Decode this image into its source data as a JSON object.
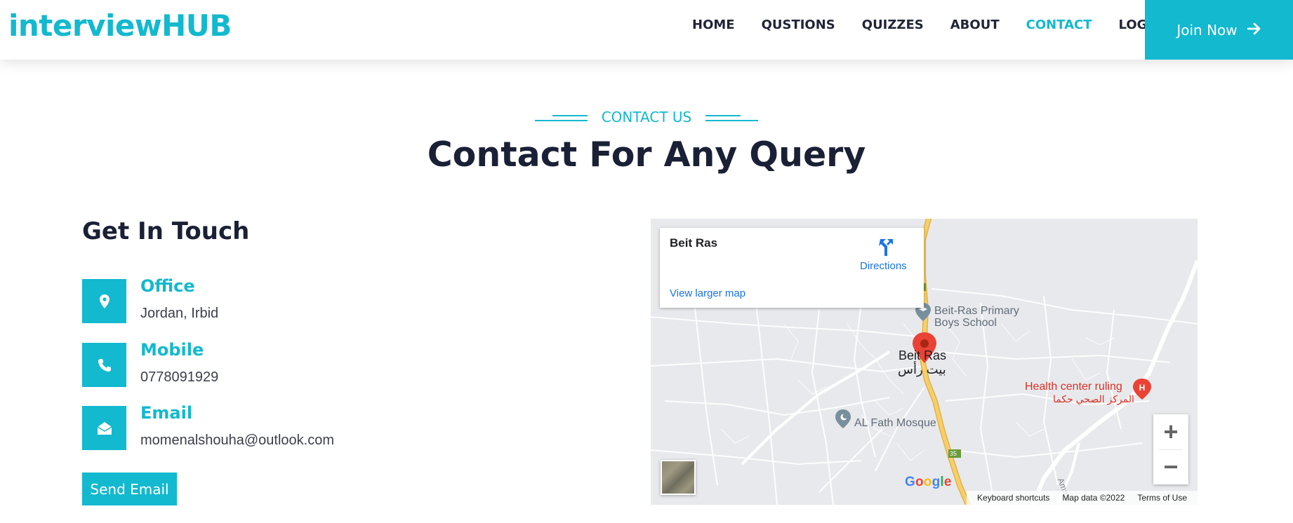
{
  "header": {
    "logo": "interviewHUB",
    "nav": [
      {
        "label": "HOME",
        "active": false
      },
      {
        "label": "QUSTIONS",
        "active": false
      },
      {
        "label": "QUIZZES",
        "active": false
      },
      {
        "label": "ABOUT",
        "active": false
      },
      {
        "label": "CONTACT",
        "active": true
      },
      {
        "label": "LOGIN",
        "active": false
      }
    ],
    "join_label": "Join Now",
    "join_icon": "arrow-right-icon"
  },
  "section": {
    "subtitle": "CONTACT US",
    "title": "Contact For Any Query"
  },
  "contact": {
    "heading": "Get In Touch",
    "items": [
      {
        "label": "Office",
        "value": "Jordan, Irbid",
        "icon": "map-pin-icon"
      },
      {
        "label": "Mobile",
        "value": "0778091929",
        "icon": "phone-icon"
      },
      {
        "label": "Email",
        "value": "momenalshouha@outlook.com",
        "icon": "envelope-open-icon"
      }
    ],
    "send_label": "Send Email"
  },
  "map": {
    "place_name": "Beit Ras",
    "directions_label": "Directions",
    "larger_map_label": "View larger map",
    "labels": {
      "school_line1": "Beit-Ras Primary",
      "school_line2": "Boys School",
      "town_en": "Beit Ras",
      "town_ar": "بيت رأس",
      "health_en": "Health center ruling",
      "health_ar": "المركز الصحي حكما",
      "mosque": "AL Fath Mosque",
      "road_1": "35",
      "road_2": "35",
      "road_3": "35",
      "side_road": "Amme"
    },
    "google": "Google",
    "attribution": {
      "shortcuts": "Keyboard shortcuts",
      "map_data": "Map data ©2022",
      "terms": "Terms of Use"
    },
    "colors": {
      "accent": "#12b9cf",
      "pin": "#ea4335",
      "road": "#f7cf6a",
      "link": "#1a73e8"
    }
  }
}
